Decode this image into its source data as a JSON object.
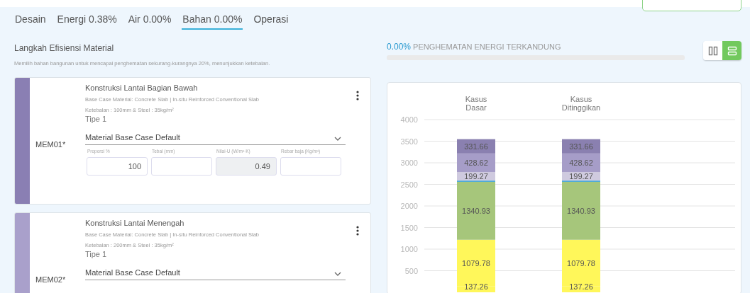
{
  "tabs": [
    {
      "label": "Desain",
      "selected": false
    },
    {
      "label": "Energi 0.38%",
      "selected": false
    },
    {
      "label": "Air 0.00%",
      "selected": false
    },
    {
      "label": "Bahan 0.00%",
      "selected": true
    },
    {
      "label": "Operasi",
      "selected": false
    }
  ],
  "section": {
    "title": "Langkah Efisiensi Material",
    "description": "Memilih bahan bangunan untuk mencapai penghematan sekurang-kurangnya 20%, menunjukkan ketebalan."
  },
  "savings": {
    "value": "0.00%",
    "label": "PENGHEMATAN ENERGI TERKANDUNG",
    "level": 0
  },
  "view_toggle": [
    {
      "kind": "columns",
      "selected": false
    },
    {
      "kind": "rows",
      "selected": true
    }
  ],
  "materials": [
    {
      "code": "MEM01*",
      "color": "#8a7fb3",
      "title": "Konstruksi Lantai Bagian Bawah",
      "base_case": "Base Case Material: Concrete Slab | In-situ Reinforced Conventional Slab",
      "thickness": "Ketebalan : 100mm & Steel : 35kg/m²",
      "type": "Tipe 1",
      "selection": "Material Base Case Default",
      "fields": [
        {
          "label": "Proporsi %",
          "value": "100",
          "disabled": false
        },
        {
          "label": "Tebal (mm)",
          "disabled": false
        },
        {
          "label": "Nilai-U (W/m²·K)",
          "value": "0.49",
          "disabled": true
        },
        {
          "label": "Rebar baja (Kg/m²)",
          "disabled": false
        }
      ]
    },
    {
      "code": "MEM02*",
      "color": "#a9a0cb",
      "title": "Konstruksi Lantai Menengah",
      "base_case": "Base Case Material: Concrete Slab | In-situ Reinforced Conventional Slab",
      "thickness": "Ketebalan : 200mm & Steel : 35kg/m²",
      "type": "Tipe 1",
      "selection": "Material Base Case Default"
    }
  ],
  "chart": {
    "chart_data": {
      "type": "bar",
      "stacked": true,
      "categories": [
        "Kasus Dasar",
        "Kasus Ditinggikan"
      ],
      "ylim": [
        0,
        4000
      ],
      "yticks": [
        500,
        1000,
        1500,
        2000,
        2500,
        3000,
        3500,
        4000
      ],
      "grid": true,
      "value_labels": [
        [
          "137.26",
          "137.26"
        ],
        [
          "1079.78",
          "1079.78"
        ],
        [
          "1340.93",
          "1340.93"
        ],
        [
          null,
          null
        ],
        [
          "199.27",
          "199.27"
        ],
        [
          "428.62",
          "428.62"
        ],
        [
          "331.66",
          "331.66"
        ]
      ],
      "series": [
        {
          "color": "#fff75a",
          "values": [
            137.26,
            137.26
          ]
        },
        {
          "color": "#fff75a",
          "values": [
            1079.78,
            1079.78
          ]
        },
        {
          "color": "#a6c67b",
          "values": [
            1340.93,
            1340.93
          ]
        },
        {
          "color": "#4aa8d8",
          "values": [
            30,
            30
          ]
        },
        {
          "color": "#cfcadf",
          "values": [
            199.27,
            199.27
          ]
        },
        {
          "color": "#a69dc8",
          "values": [
            428.62,
            428.62
          ]
        },
        {
          "color": "#8a80b0",
          "values": [
            331.66,
            331.66
          ]
        }
      ]
    }
  }
}
